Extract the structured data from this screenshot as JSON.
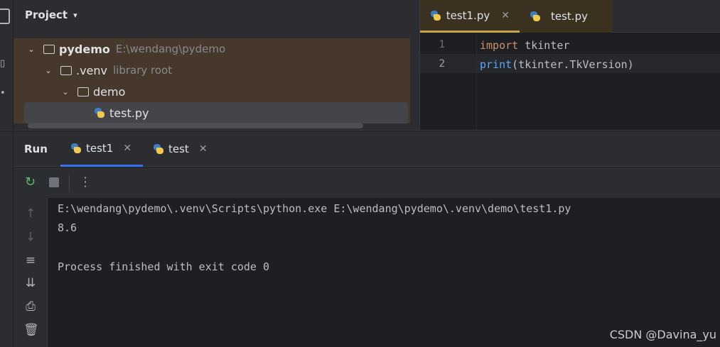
{
  "project": {
    "title": "Project",
    "root": {
      "name": "pydemo",
      "hint": "E:\\wendang\\pydemo"
    },
    "venv": {
      "name": ".venv",
      "hint": "library root"
    },
    "folder": {
      "name": "demo"
    },
    "file": {
      "name": "test.py"
    }
  },
  "editor": {
    "tabs": [
      {
        "label": "test1.py",
        "close": "✕"
      },
      {
        "label": "test.py"
      }
    ],
    "lines": [
      {
        "no": "1",
        "kw": "import",
        "rest": " tkinter"
      },
      {
        "no": "2",
        "fn": "print",
        "rest": "(tkinter.TkVersion)"
      }
    ]
  },
  "run": {
    "title": "Run",
    "tabs": [
      {
        "label": "test1",
        "close": "✕"
      },
      {
        "label": "test",
        "close": "✕"
      }
    ]
  },
  "console": {
    "lines": [
      "E:\\wendang\\pydemo\\.venv\\Scripts\\python.exe E:\\wendang\\pydemo\\.venv\\demo\\test1.py",
      "8.6",
      "Process finished with exit code 0"
    ]
  },
  "watermark": "CSDN @Davina_yu",
  "colors": {
    "keyword": "#cf8e6d",
    "function": "#56a8f5",
    "accent_tab": "#3574f0",
    "editor_tab_underline": "#c5a34a"
  }
}
